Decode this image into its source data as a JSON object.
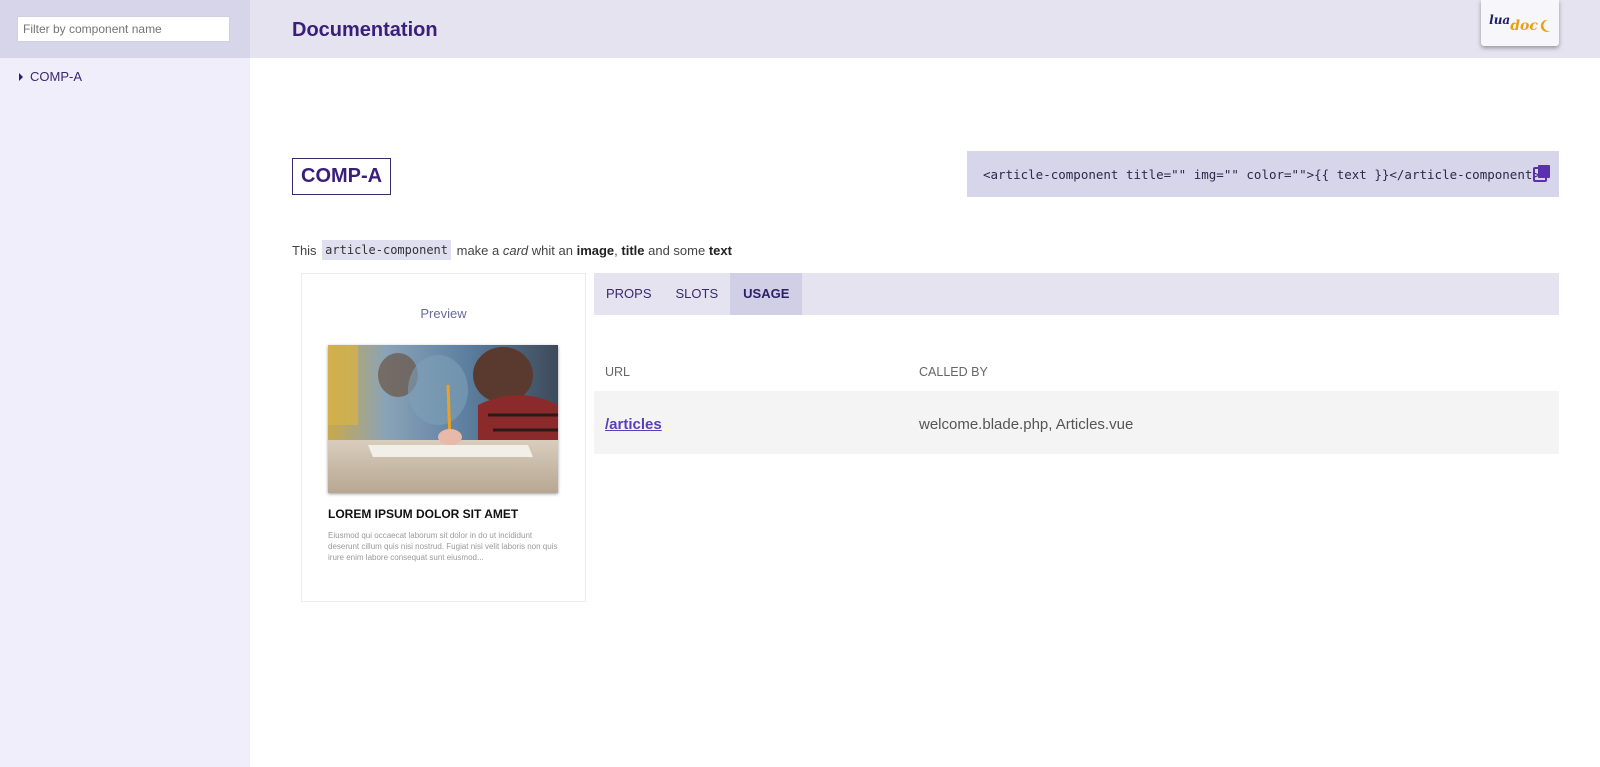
{
  "sidebar": {
    "filter_placeholder": "Filter by component name",
    "filter_value": "",
    "items": [
      {
        "label": "COMP-A"
      }
    ]
  },
  "header": {
    "title": "Documentation",
    "logo": {
      "part1": "lua",
      "part2": "doc"
    }
  },
  "component": {
    "title": "COMP-A",
    "code_snippet": "<article-component title=\"\" img=\"\" color=\"\">{{ text }}</article-component>",
    "description": {
      "p1": "This ",
      "code": "article-component",
      "p2": " make a ",
      "em": "card",
      "p3": " whit an ",
      "b1": "image",
      "p4": ", ",
      "b2": "title",
      "p5": " and some ",
      "b3": "text"
    }
  },
  "preview": {
    "label": "Preview",
    "card_title": "LOREM IPSUM DOLOR SIT AMET",
    "card_text": "Eiusmod qui occaecat laborum sit dolor in do ut incididunt deserunt cillum quis nisi nostrud. Fugiat nisi velit laboris non quis irure enim labore consequat sunt eiusmod..."
  },
  "tabs": [
    {
      "label": "PROPS",
      "active": false
    },
    {
      "label": "SLOTS",
      "active": false
    },
    {
      "label": "USAGE",
      "active": true
    }
  ],
  "usage": {
    "headers": {
      "url": "URL",
      "called_by": "CALLED BY"
    },
    "rows": [
      {
        "url": "/articles",
        "called_by": "welcome.blade.php, Articles.vue"
      }
    ]
  },
  "colors": {
    "accent": "#3a1f7a",
    "sidebar_bg": "#efeefa",
    "header_bg": "#e4e3ef",
    "link": "#5a3fb8"
  },
  "icons": {
    "copy": "copy-icon",
    "caret": "caret-right-icon"
  }
}
